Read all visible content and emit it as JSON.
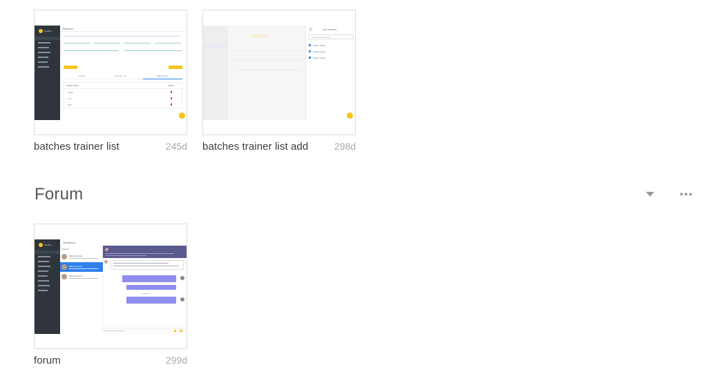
{
  "cards_top": [
    {
      "name": "batches trainer list",
      "age": "245d",
      "mock": {
        "brand": "Pipeline",
        "header": "Batches",
        "tabs": [
          "Details",
          "Schedule List",
          "Trainers List"
        ],
        "table_headers": [
          "Trainer Name",
          "Actions"
        ],
        "rows": [
          "Name",
          "Test",
          "Sam"
        ]
      }
    },
    {
      "name": "batches trainer list add",
      "age": "298d",
      "mock": {
        "panel_title": "ADD TRAINER",
        "search_placeholder": "Search trainer name",
        "options": [
          "Trainer Name",
          "Trainer Name",
          "Trainer Name"
        ]
      }
    }
  ],
  "section": {
    "title": "Forum"
  },
  "cards_forum": [
    {
      "name": "forum",
      "age": "299d",
      "mock": {
        "brand": "Pipeline",
        "header": "Questions",
        "search": "Search",
        "thread_names": [
          "Mark Simpson",
          "Mark Simpson",
          "Mark Simpson"
        ]
      }
    }
  ],
  "colors": {
    "sidebar": "#2e353d",
    "accent_yellow": "#f7c21b",
    "accent_blue": "#2f80ed",
    "forum_purple": "#5b5a8f",
    "bubble": "#8e8df0"
  }
}
